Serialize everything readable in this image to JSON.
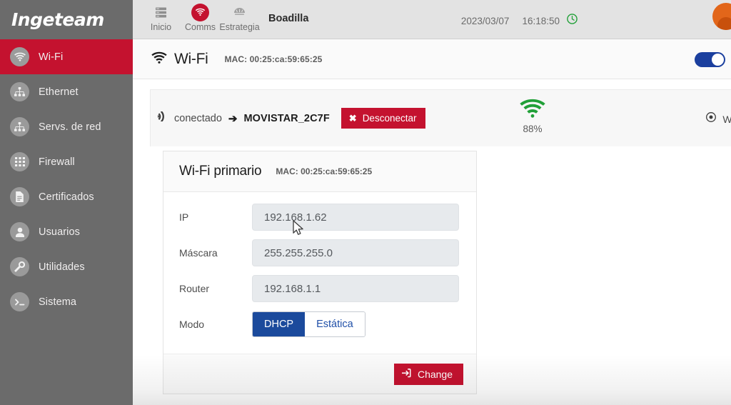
{
  "brand": {
    "name": "Ingeteam"
  },
  "sidebar": {
    "items": [
      {
        "label": "Wi-Fi",
        "icon": "wifi-icon",
        "active": true
      },
      {
        "label": "Ethernet",
        "icon": "network-icon",
        "active": false
      },
      {
        "label": "Servs. de red",
        "icon": "sitemap-icon",
        "active": false
      },
      {
        "label": "Firewall",
        "icon": "grid-icon",
        "active": false
      },
      {
        "label": "Certificados",
        "icon": "document-icon",
        "active": false
      },
      {
        "label": "Usuarios",
        "icon": "user-icon",
        "active": false
      },
      {
        "label": "Utilidades",
        "icon": "wrench-icon",
        "active": false
      },
      {
        "label": "Sistema",
        "icon": "terminal-icon",
        "active": false
      }
    ]
  },
  "topbar": {
    "nav": [
      {
        "label": "Inicio",
        "icon": "server-icon",
        "active": false
      },
      {
        "label": "Comms",
        "icon": "wifi-icon",
        "active": true
      },
      {
        "label": "Estrategia",
        "icon": "strategy-icon",
        "active": false
      }
    ],
    "site": "Boadilla",
    "date": "2023/03/07",
    "time": "16:18:50",
    "clock_icon": "clock-icon",
    "avatar": "user-avatar",
    "accent_red": "#c4122f",
    "accent_green": "#21a038"
  },
  "page_header": {
    "icon": "wifi-icon",
    "title": "Wi-Fi",
    "mac": "MAC: 00:25:ca:59:65:25",
    "toggle_on": true,
    "toggle_color": "#1b3f9e"
  },
  "status": {
    "signal_icon": "rss-icon",
    "state": "conectado",
    "arrow": "➔",
    "ssid": "MOVISTAR_2C7F",
    "disconnect_label": "Desconectar",
    "disconnect_icon": "close-icon",
    "disconnect_color": "#c4122f",
    "signal_strength": "88%",
    "signal_color": "#21a038",
    "working_mode_icon": "target-icon",
    "working_mode_label": "Working m"
  },
  "card": {
    "title": "Wi-Fi primario",
    "mac": "MAC: 00:25:ca:59:65:25",
    "fields": [
      {
        "label": "IP",
        "value": "192.168.1.62"
      },
      {
        "label": "Máscara",
        "value": "255.255.255.0"
      },
      {
        "label": "Router",
        "value": "192.168.1.1"
      }
    ],
    "mode": {
      "label": "Modo",
      "options": [
        "DHCP",
        "Estática"
      ],
      "selected": "DHCP",
      "selected_color": "#1b4a9c"
    },
    "submit_label": "Change",
    "submit_icon": "signin-icon",
    "submit_color": "#c4122f"
  },
  "cursor": {
    "type": "arrow-pointer"
  }
}
